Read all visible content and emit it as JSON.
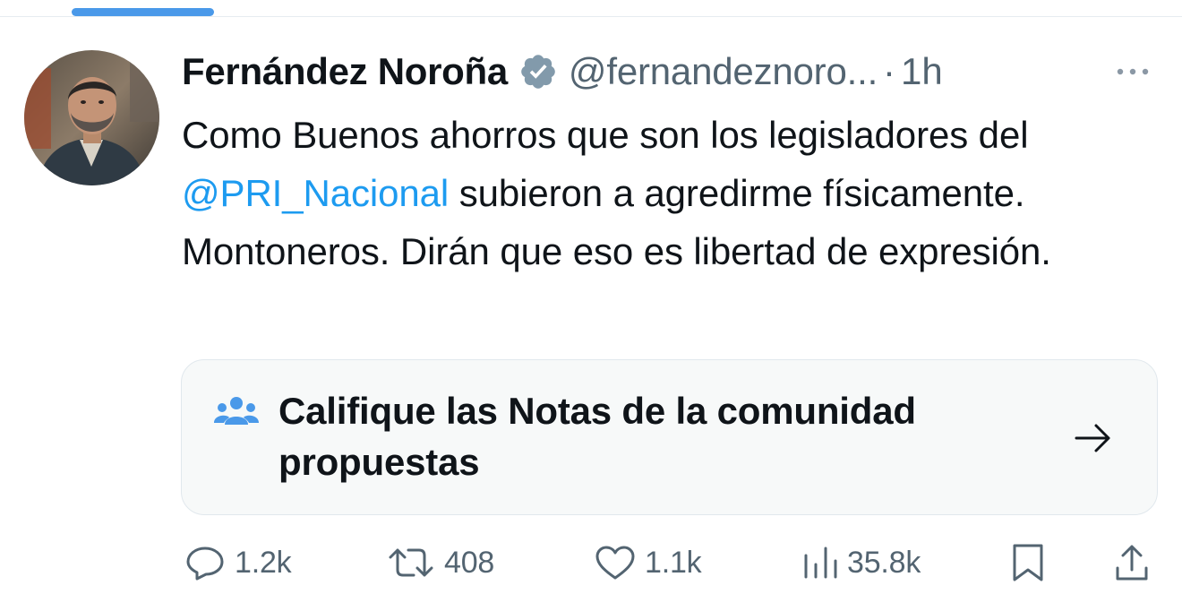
{
  "tweet": {
    "display_name": "Fernández Noroña",
    "handle": "@fernandeznoro...",
    "separator": "·",
    "time": "1h",
    "text_part1": "Como Buenos ahorros que son los legisladores del ",
    "mention": "@PRI_Nacional",
    "text_part2": " subieron a agredirme físicamente. Montoneros. Dirán que eso es libertad de expresión."
  },
  "community_notes": {
    "title": "Califique las Notas de la comunidad propuestas"
  },
  "actions": {
    "replies": "1.2k",
    "retweets": "408",
    "likes": "1.1k",
    "views": "35.8k"
  },
  "colors": {
    "accent": "#1d9bf0",
    "tab_indicator": "#4a99e9",
    "secondary_text": "#536471",
    "verified_badge": "#829aab",
    "notes_icon": "#4a99e9",
    "card_background": "#f7f9f9"
  },
  "icons": {
    "verified": "verified-badge-icon",
    "more": "more-horizontal-icon",
    "community_notes": "people-group-icon",
    "arrow": "arrow-right-icon",
    "reply": "speech-bubble-icon",
    "retweet": "retweet-icon",
    "like": "heart-icon",
    "views": "bar-chart-icon",
    "bookmark": "bookmark-icon",
    "share": "share-icon"
  }
}
